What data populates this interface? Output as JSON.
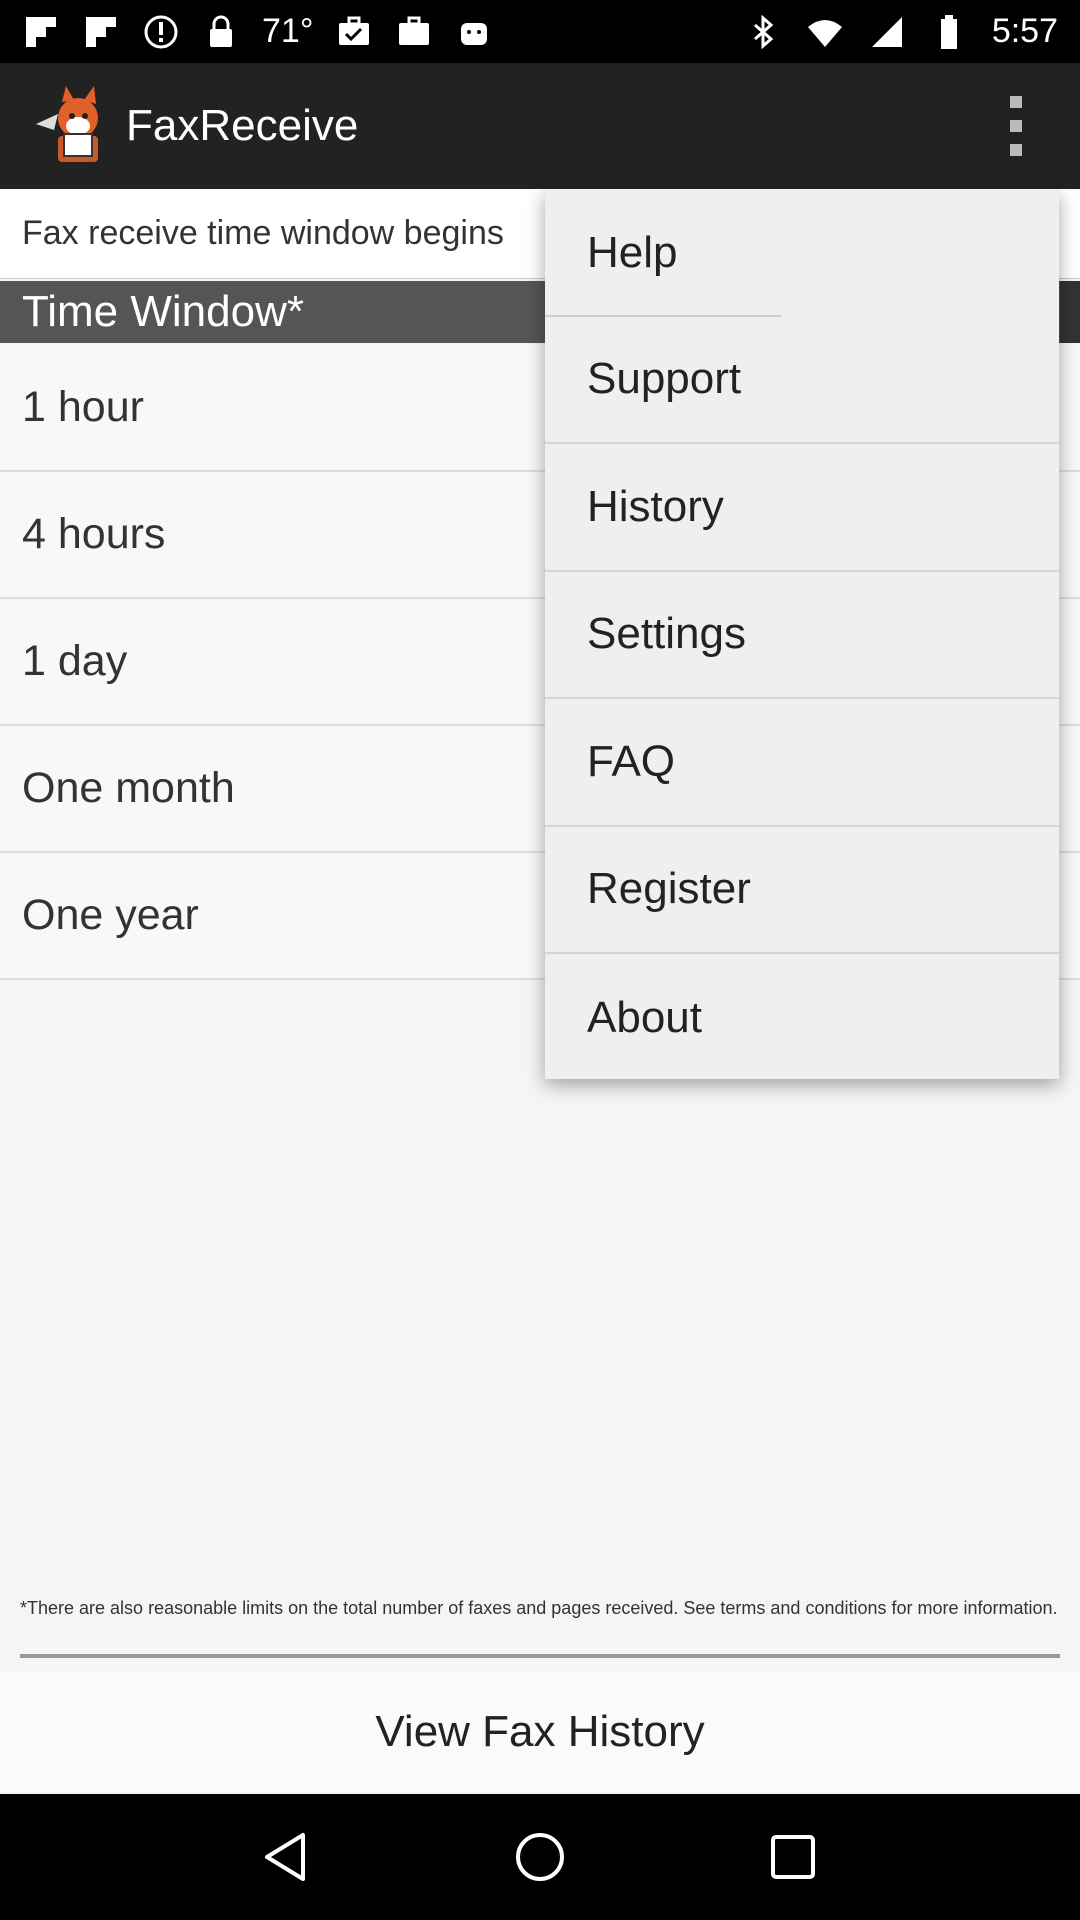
{
  "status_bar": {
    "temperature": "71°",
    "time": "5:57"
  },
  "app": {
    "title": "FaxReceive"
  },
  "content": {
    "info_text": "Fax receive time window begins",
    "section_header": "Time Window*",
    "options": [
      "1 hour",
      "4 hours",
      "1 day",
      "One month",
      "One year"
    ]
  },
  "menu": {
    "items": [
      "Help",
      "Support",
      "History",
      "Settings",
      "FAQ",
      "Register",
      "About"
    ]
  },
  "footer": {
    "note": "*There are also reasonable limits on the total number of faxes and pages received. See terms and conditions for more information.",
    "view_history_label": "View Fax History"
  },
  "icons": {
    "status_left": [
      "flipboard-icon",
      "flipboard-icon",
      "alert-icon",
      "lock-icon",
      "briefcase-check-icon",
      "briefcase-icon",
      "android-icon"
    ],
    "status_right": [
      "bluetooth-icon",
      "wifi-icon",
      "signal-icon",
      "battery-icon"
    ]
  },
  "colors": {
    "app_bar": "#222222",
    "section_header": "#555555",
    "menu_bg": "#efefef"
  }
}
